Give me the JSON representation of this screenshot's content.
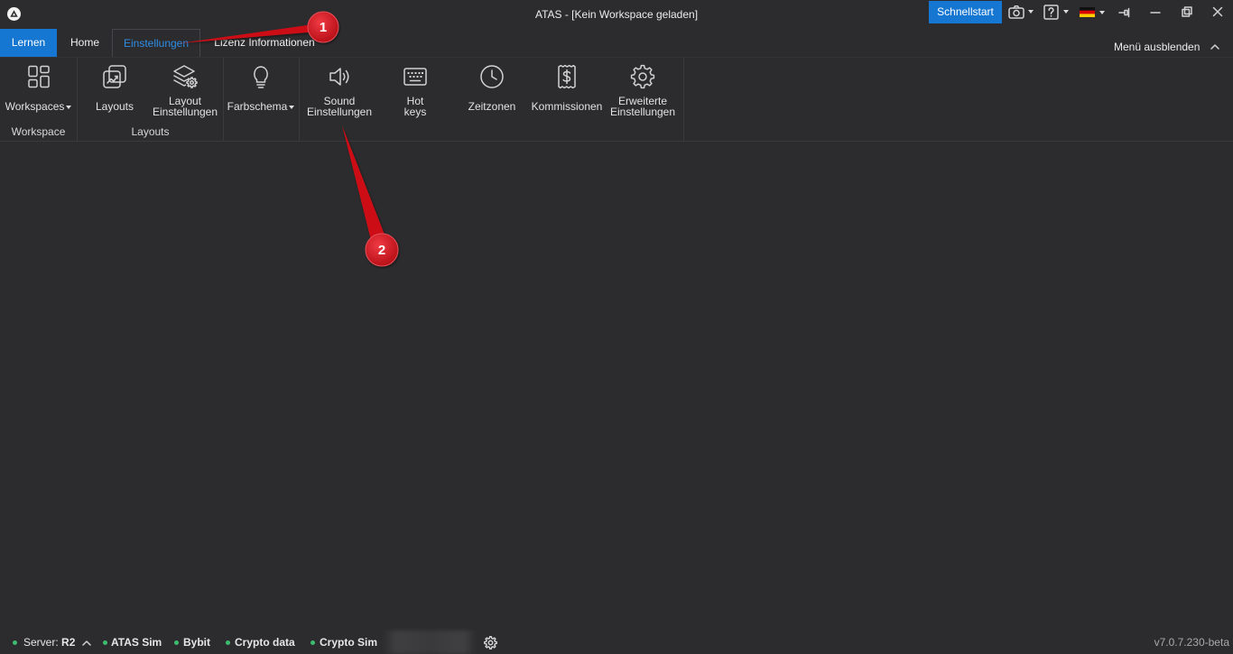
{
  "window": {
    "title": "ATAS - [Kein Workspace geladen]",
    "logo_icon": "atas-logo-icon"
  },
  "titlebar": {
    "quickstart_label": "Schnellstart",
    "controls": [
      {
        "icon": "camera-icon",
        "dropdown": true
      },
      {
        "icon": "help-icon",
        "dropdown": true
      },
      {
        "icon": "german-flag-icon",
        "dropdown": true
      },
      {
        "icon": "pin-icon"
      },
      {
        "icon": "minimize-icon"
      },
      {
        "icon": "restore-icon"
      },
      {
        "icon": "close-icon"
      }
    ]
  },
  "tabs": [
    {
      "label": "Lernen"
    },
    {
      "label": "Home"
    },
    {
      "label": "Einstellungen",
      "active": true
    },
    {
      "label": "Lizenz Informationen"
    }
  ],
  "menu_toggle": {
    "label": "Menü ausblenden",
    "icon": "chevron-up-icon"
  },
  "ribbon": {
    "groups": [
      {
        "label": "Workspace",
        "items": [
          {
            "icon": "workspaces-grid-icon",
            "label_lines": [
              "Workspaces"
            ],
            "dropdown": true
          }
        ]
      },
      {
        "label": "Layouts",
        "items": [
          {
            "icon": "layouts-chart-icon",
            "label_lines": [
              "Layouts"
            ]
          },
          {
            "icon": "layout-settings-icon",
            "label_lines": [
              "Layout",
              "Einstellungen"
            ]
          }
        ]
      },
      {
        "items": [
          {
            "icon": "lightbulb-icon",
            "label_lines": [
              "Farbschema"
            ],
            "dropdown": true
          }
        ]
      },
      {
        "items": [
          {
            "icon": "speaker-icon",
            "label_lines": [
              "Sound",
              "Einstellungen"
            ]
          },
          {
            "icon": "keyboard-icon",
            "label_lines": [
              "Hot",
              "keys"
            ]
          },
          {
            "icon": "clock-icon",
            "label_lines": [
              "Zeitzonen"
            ]
          },
          {
            "icon": "receipt-dollar-icon",
            "label_lines": [
              "Kommissionen"
            ]
          },
          {
            "icon": "gear-icon",
            "label_lines": [
              "Erweiterte",
              "Einstellungen"
            ]
          }
        ]
      }
    ]
  },
  "status_bar": {
    "connections": [
      {
        "label": "Server:",
        "value": "R2"
      },
      {
        "value": "ATAS Sim"
      },
      {
        "value": "Bybit"
      },
      {
        "value": "Crypto data"
      },
      {
        "value": "Crypto Sim"
      }
    ],
    "indicator_color": "#3dbb6e",
    "expand_icon": "chevron-up-icon",
    "settings_icon": "gear-icon",
    "version": "v7.0.7.230-beta"
  },
  "annotations": [
    {
      "label": "1"
    },
    {
      "label": "2"
    }
  ],
  "colors": {
    "background": "#2c2c2e",
    "accent": "#1677d2",
    "active_tab_text": "#2f8de4",
    "annotation": "#cc1019"
  }
}
